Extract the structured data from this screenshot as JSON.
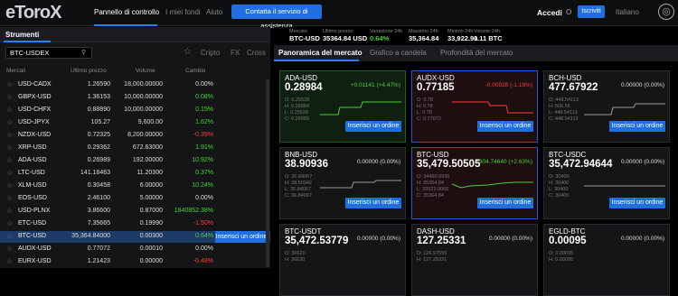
{
  "header": {
    "logo": "eToro",
    "logo_x": "X",
    "nav": [
      "Pannello di controllo",
      "I miei fondi",
      "Aiuto"
    ],
    "assist_button": "Contatta il servizio di assistenza",
    "login": "Accedi",
    "or": "O",
    "signup": "Iscriviti",
    "language": "Italiano"
  },
  "left": {
    "title": "Strumenti",
    "search_value": "BTC-USDEX",
    "tabs": [
      "Cripto",
      "FX",
      "Cross"
    ],
    "columns": [
      "Mercati",
      "Ultimo prezzo",
      "Volume",
      "Cambio"
    ],
    "rows": [
      {
        "sym": "USD-CADX",
        "price": "1.26590",
        "vol": "18,000.00000",
        "chg": "0.00%",
        "dir": "flat"
      },
      {
        "sym": "GBPX-USD",
        "price": "1.36153",
        "vol": "10,000.00000",
        "chg": "0.08%",
        "dir": "up"
      },
      {
        "sym": "USD-CHFX",
        "price": "0.88890",
        "vol": "10,000.00000",
        "chg": "0.15%",
        "dir": "up"
      },
      {
        "sym": "USD-JPYX",
        "price": "105.27",
        "vol": "9,600.00",
        "chg": "1.62%",
        "dir": "up"
      },
      {
        "sym": "NZDX-USD",
        "price": "0.72325",
        "vol": "8,200.00000",
        "chg": "-0.39%",
        "dir": "down"
      },
      {
        "sym": "XRP-USD",
        "price": "0.29362",
        "vol": "672.63000",
        "chg": "1.91%",
        "dir": "up"
      },
      {
        "sym": "ADA-USD",
        "price": "0.26989",
        "vol": "192.00000",
        "chg": "10.92%",
        "dir": "up"
      },
      {
        "sym": "LTC-USD",
        "price": "141.18463",
        "vol": "11.20300",
        "chg": "0.37%",
        "dir": "up"
      },
      {
        "sym": "XLM-USD",
        "price": "0.30458",
        "vol": "6.00000",
        "chg": "10.24%",
        "dir": "up"
      },
      {
        "sym": "EOS-USD",
        "price": "2.46100",
        "vol": "5.00000",
        "chg": "0.00%",
        "dir": "flat"
      },
      {
        "sym": "USD-PLNX",
        "price": "3.86600",
        "vol": "0.87000",
        "chg": "1840852.38%",
        "dir": "up"
      },
      {
        "sym": "ETC-USD",
        "price": "7.35665",
        "vol": "0.19990",
        "chg": "-1.50%",
        "dir": "down"
      },
      {
        "sym": "BTC-USD",
        "price": "35,364.84000",
        "vol": "0.00300",
        "chg": "0.64%",
        "dir": "up",
        "selected": true
      },
      {
        "sym": "AUDX-USD",
        "price": "0.77072",
        "vol": "0.00010",
        "chg": "0.00%",
        "dir": "flat"
      },
      {
        "sym": "EURX-USD",
        "price": "1.21423",
        "vol": "0.00000",
        "chg": "-0.48%",
        "dir": "down"
      }
    ],
    "row_button": "Inserisci un ordine"
  },
  "ticker": {
    "labels": [
      "Mercato",
      "Ultimo prezzo",
      "Variazione 24h",
      "Massimo 24h",
      "Minimo 24h",
      "Volume 24h"
    ],
    "values": [
      "BTC-USD",
      "35364.84 USD",
      "0.64%",
      "35,364.84",
      "33,922.91",
      "0.11 BTC"
    ]
  },
  "tabs": [
    "Panoramica del mercato",
    "Grafico a candela",
    "Profondità del mercato"
  ],
  "cards": [
    {
      "sym": "ADA-USD",
      "price": "0.28984",
      "chg": "+0.01141 (+4.47%)",
      "dir": "up",
      "style": "g",
      "stats": [
        "O: 0.25528",
        "H: 0.28984",
        "L: 0.25528",
        "C: 0.26989"
      ]
    },
    {
      "sym": "AUDX-USD",
      "price": "0.77185",
      "chg": "-0.00928 (-1.19%)",
      "dir": "down",
      "style": "r",
      "stats": [
        "O: 0.78",
        "H: 0.78",
        "L: 0.78",
        "C: 0.77072"
      ]
    },
    {
      "sym": "BCH-USD",
      "price": "477.67922",
      "chg": "0.00000 (0.00%)",
      "dir": "flat",
      "style": "",
      "stats": [
        "O: 448.54113",
        "H: 506.55",
        "L: 448.54113",
        "C: 448.54113"
      ]
    },
    {
      "sym": "BNB-USD",
      "price": "38.90936",
      "chg": "0.00000 (0.00%)",
      "dir": "flat",
      "style": "",
      "stats": [
        "O: 36.84067",
        "H: 38.50342",
        "L: 36.84067",
        "C: 36.84067"
      ]
    },
    {
      "sym": "BTC-USD",
      "price": "35,479.50505",
      "chg": "+904.74640 (+2.63%)",
      "dir": "up",
      "style": "r",
      "stats": [
        "O: 34460.0936",
        "H: 35364.84",
        "L: 33922.9066",
        "C: 35364.84"
      ]
    },
    {
      "sym": "BTC-USDC",
      "price": "35,472.94644",
      "chg": "0.00000 (0.00%)",
      "dir": "flat",
      "style": "",
      "stats": [
        "O: 30400",
        "H: 30400",
        "L: 30400",
        "C: 30400"
      ]
    },
    {
      "sym": "BTC-USDT",
      "price": "35,472.53779",
      "chg": "0.00000 (0.00%)",
      "dir": "flat",
      "style": "",
      "stats": [
        "O: 36620",
        "H: 36620"
      ]
    },
    {
      "sym": "DASH-USD",
      "price": "127.25331",
      "chg": "0.00000 (0.00%)",
      "dir": "flat",
      "style": "",
      "stats": [
        "O: 126.97555",
        "H: 127.25331"
      ]
    },
    {
      "sym": "EGLD-BTC",
      "price": "0.00095",
      "chg": "0.00000 (0.00%)",
      "dir": "flat",
      "style": "",
      "stats": [
        "O: 0.00095",
        "H: 0.00095"
      ]
    }
  ],
  "card_button": "Inserisci un ordine"
}
